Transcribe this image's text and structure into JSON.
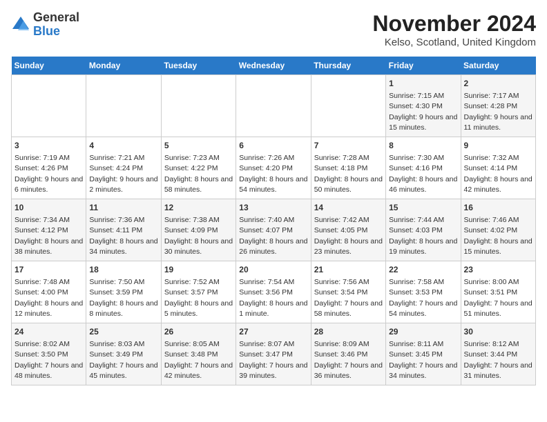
{
  "header": {
    "logo_general": "General",
    "logo_blue": "Blue",
    "title": "November 2024",
    "subtitle": "Kelso, Scotland, United Kingdom"
  },
  "calendar": {
    "weekdays": [
      "Sunday",
      "Monday",
      "Tuesday",
      "Wednesday",
      "Thursday",
      "Friday",
      "Saturday"
    ],
    "weeks": [
      [
        {
          "day": "",
          "info": ""
        },
        {
          "day": "",
          "info": ""
        },
        {
          "day": "",
          "info": ""
        },
        {
          "day": "",
          "info": ""
        },
        {
          "day": "",
          "info": ""
        },
        {
          "day": "1",
          "info": "Sunrise: 7:15 AM\nSunset: 4:30 PM\nDaylight: 9 hours and 15 minutes."
        },
        {
          "day": "2",
          "info": "Sunrise: 7:17 AM\nSunset: 4:28 PM\nDaylight: 9 hours and 11 minutes."
        }
      ],
      [
        {
          "day": "3",
          "info": "Sunrise: 7:19 AM\nSunset: 4:26 PM\nDaylight: 9 hours and 6 minutes."
        },
        {
          "day": "4",
          "info": "Sunrise: 7:21 AM\nSunset: 4:24 PM\nDaylight: 9 hours and 2 minutes."
        },
        {
          "day": "5",
          "info": "Sunrise: 7:23 AM\nSunset: 4:22 PM\nDaylight: 8 hours and 58 minutes."
        },
        {
          "day": "6",
          "info": "Sunrise: 7:26 AM\nSunset: 4:20 PM\nDaylight: 8 hours and 54 minutes."
        },
        {
          "day": "7",
          "info": "Sunrise: 7:28 AM\nSunset: 4:18 PM\nDaylight: 8 hours and 50 minutes."
        },
        {
          "day": "8",
          "info": "Sunrise: 7:30 AM\nSunset: 4:16 PM\nDaylight: 8 hours and 46 minutes."
        },
        {
          "day": "9",
          "info": "Sunrise: 7:32 AM\nSunset: 4:14 PM\nDaylight: 8 hours and 42 minutes."
        }
      ],
      [
        {
          "day": "10",
          "info": "Sunrise: 7:34 AM\nSunset: 4:12 PM\nDaylight: 8 hours and 38 minutes."
        },
        {
          "day": "11",
          "info": "Sunrise: 7:36 AM\nSunset: 4:11 PM\nDaylight: 8 hours and 34 minutes."
        },
        {
          "day": "12",
          "info": "Sunrise: 7:38 AM\nSunset: 4:09 PM\nDaylight: 8 hours and 30 minutes."
        },
        {
          "day": "13",
          "info": "Sunrise: 7:40 AM\nSunset: 4:07 PM\nDaylight: 8 hours and 26 minutes."
        },
        {
          "day": "14",
          "info": "Sunrise: 7:42 AM\nSunset: 4:05 PM\nDaylight: 8 hours and 23 minutes."
        },
        {
          "day": "15",
          "info": "Sunrise: 7:44 AM\nSunset: 4:03 PM\nDaylight: 8 hours and 19 minutes."
        },
        {
          "day": "16",
          "info": "Sunrise: 7:46 AM\nSunset: 4:02 PM\nDaylight: 8 hours and 15 minutes."
        }
      ],
      [
        {
          "day": "17",
          "info": "Sunrise: 7:48 AM\nSunset: 4:00 PM\nDaylight: 8 hours and 12 minutes."
        },
        {
          "day": "18",
          "info": "Sunrise: 7:50 AM\nSunset: 3:59 PM\nDaylight: 8 hours and 8 minutes."
        },
        {
          "day": "19",
          "info": "Sunrise: 7:52 AM\nSunset: 3:57 PM\nDaylight: 8 hours and 5 minutes."
        },
        {
          "day": "20",
          "info": "Sunrise: 7:54 AM\nSunset: 3:56 PM\nDaylight: 8 hours and 1 minute."
        },
        {
          "day": "21",
          "info": "Sunrise: 7:56 AM\nSunset: 3:54 PM\nDaylight: 7 hours and 58 minutes."
        },
        {
          "day": "22",
          "info": "Sunrise: 7:58 AM\nSunset: 3:53 PM\nDaylight: 7 hours and 54 minutes."
        },
        {
          "day": "23",
          "info": "Sunrise: 8:00 AM\nSunset: 3:51 PM\nDaylight: 7 hours and 51 minutes."
        }
      ],
      [
        {
          "day": "24",
          "info": "Sunrise: 8:02 AM\nSunset: 3:50 PM\nDaylight: 7 hours and 48 minutes."
        },
        {
          "day": "25",
          "info": "Sunrise: 8:03 AM\nSunset: 3:49 PM\nDaylight: 7 hours and 45 minutes."
        },
        {
          "day": "26",
          "info": "Sunrise: 8:05 AM\nSunset: 3:48 PM\nDaylight: 7 hours and 42 minutes."
        },
        {
          "day": "27",
          "info": "Sunrise: 8:07 AM\nSunset: 3:47 PM\nDaylight: 7 hours and 39 minutes."
        },
        {
          "day": "28",
          "info": "Sunrise: 8:09 AM\nSunset: 3:46 PM\nDaylight: 7 hours and 36 minutes."
        },
        {
          "day": "29",
          "info": "Sunrise: 8:11 AM\nSunset: 3:45 PM\nDaylight: 7 hours and 34 minutes."
        },
        {
          "day": "30",
          "info": "Sunrise: 8:12 AM\nSunset: 3:44 PM\nDaylight: 7 hours and 31 minutes."
        }
      ]
    ]
  }
}
